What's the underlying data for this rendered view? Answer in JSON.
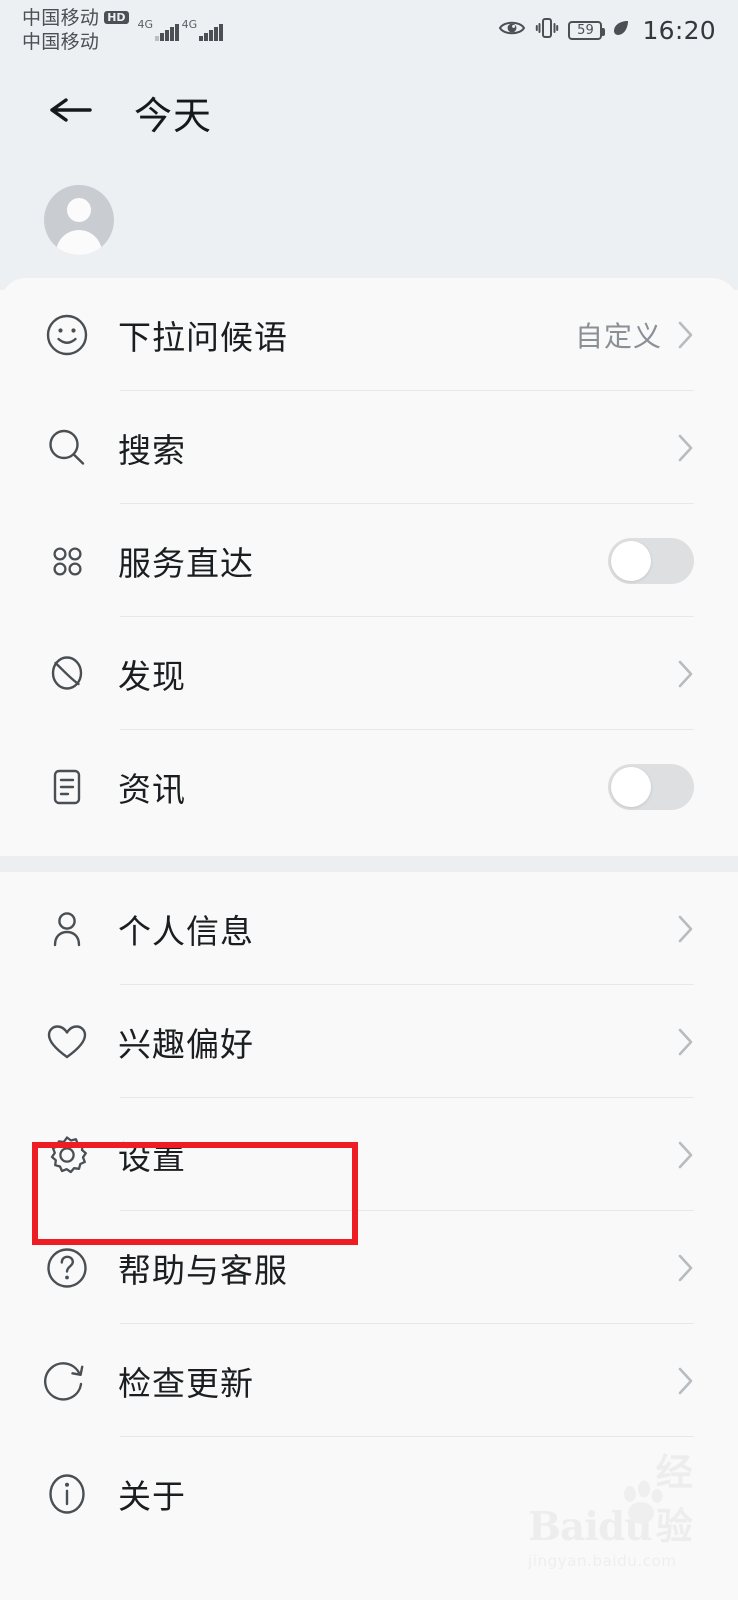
{
  "status_bar": {
    "carrier_primary": "中国移动",
    "carrier_secondary": "中国移动",
    "hd_badge": "HD",
    "network_type_1": "4G",
    "network_type_2": "4G",
    "battery_percent": "59",
    "time": "16:20",
    "icons": [
      "eye-comfort-icon",
      "vibrate-icon",
      "battery-icon",
      "leaf-power-saving-icon"
    ]
  },
  "header": {
    "back_icon": "arrow-left-icon",
    "title": "今天"
  },
  "profile": {
    "avatar_icon": "user-avatar-placeholder-icon"
  },
  "sections": [
    {
      "name": "display-settings",
      "items": [
        {
          "icon": "smiley-face-icon",
          "label": "下拉问候语",
          "value": "自定义",
          "control": "chevron"
        },
        {
          "icon": "search-icon",
          "label": "搜索",
          "value": "",
          "control": "chevron"
        },
        {
          "icon": "grid-dots-icon",
          "label": "服务直达",
          "value": "",
          "control": "toggle",
          "toggle_on": false
        },
        {
          "icon": "discover-icon",
          "label": "发现",
          "value": "",
          "control": "chevron"
        },
        {
          "icon": "news-document-icon",
          "label": "资讯",
          "value": "",
          "control": "toggle",
          "toggle_on": false
        }
      ]
    },
    {
      "name": "account-settings",
      "items": [
        {
          "icon": "person-icon",
          "label": "个人信息",
          "value": "",
          "control": "chevron"
        },
        {
          "icon": "heart-icon",
          "label": "兴趣偏好",
          "value": "",
          "control": "chevron"
        },
        {
          "icon": "gear-icon",
          "label": "设置",
          "value": "",
          "control": "chevron",
          "highlighted": true
        },
        {
          "icon": "question-mark-icon",
          "label": "帮助与客服",
          "value": "",
          "control": "chevron"
        },
        {
          "icon": "refresh-icon",
          "label": "检查更新",
          "value": "",
          "control": "chevron"
        },
        {
          "icon": "info-icon",
          "label": "关于",
          "value": "",
          "control": "chevron"
        }
      ]
    }
  ],
  "annotation": {
    "type": "red-rectangle-highlight",
    "target_label": "设置",
    "color": "#ee1c23"
  },
  "watermark": {
    "brand": "Baidu",
    "brand_cn": "经验",
    "url": "jingyan.baidu.com"
  },
  "colors": {
    "header_bg": "#ecf0f3",
    "card_bg": "#f9f9f9",
    "text_primary": "#1b1e21",
    "text_secondary": "#8a9096",
    "divider": "#e8e8e8",
    "toggle_off": "#dddfe1",
    "annotation_red": "#ee1c23"
  }
}
